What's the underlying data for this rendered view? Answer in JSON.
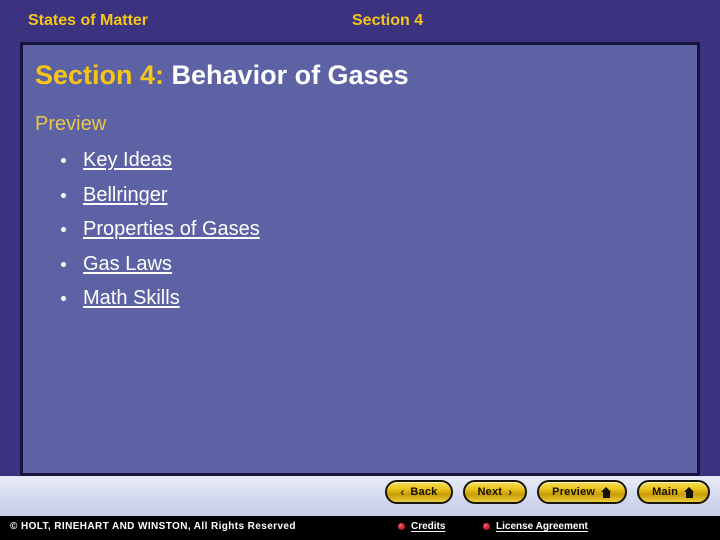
{
  "header": {
    "course_title": "States of Matter",
    "section_label": "Section 4"
  },
  "slide": {
    "title_accent": "Section 4:",
    "title_main": " Behavior of Gases",
    "preview_label": "Preview",
    "preview_items": [
      {
        "label": "Key Ideas"
      },
      {
        "label": "Bellringer"
      },
      {
        "label": "Properties of Gases"
      },
      {
        "label": "Gas Laws"
      },
      {
        "label": "Math Skills"
      }
    ]
  },
  "navigation": {
    "back_label": "Back",
    "back_chevron": "‹",
    "next_label": "Next",
    "next_chevron": "›",
    "preview_label": "Preview",
    "main_label": "Main"
  },
  "footer": {
    "copyright": "© HOLT, RINEHART AND WINSTON, All Rights Reserved",
    "credits_label": "Credits",
    "license_label": "License Agreement"
  },
  "colors": {
    "header_bg": "#3B3380",
    "panel_bg": "#5D62A4",
    "panel_border": "#14143C",
    "accent_gold": "#F5C518",
    "text_white": "#FFFFFF",
    "footer_bg": "#000000",
    "footer_dot": "#CC2233",
    "button_gold": "#EBC51E"
  }
}
